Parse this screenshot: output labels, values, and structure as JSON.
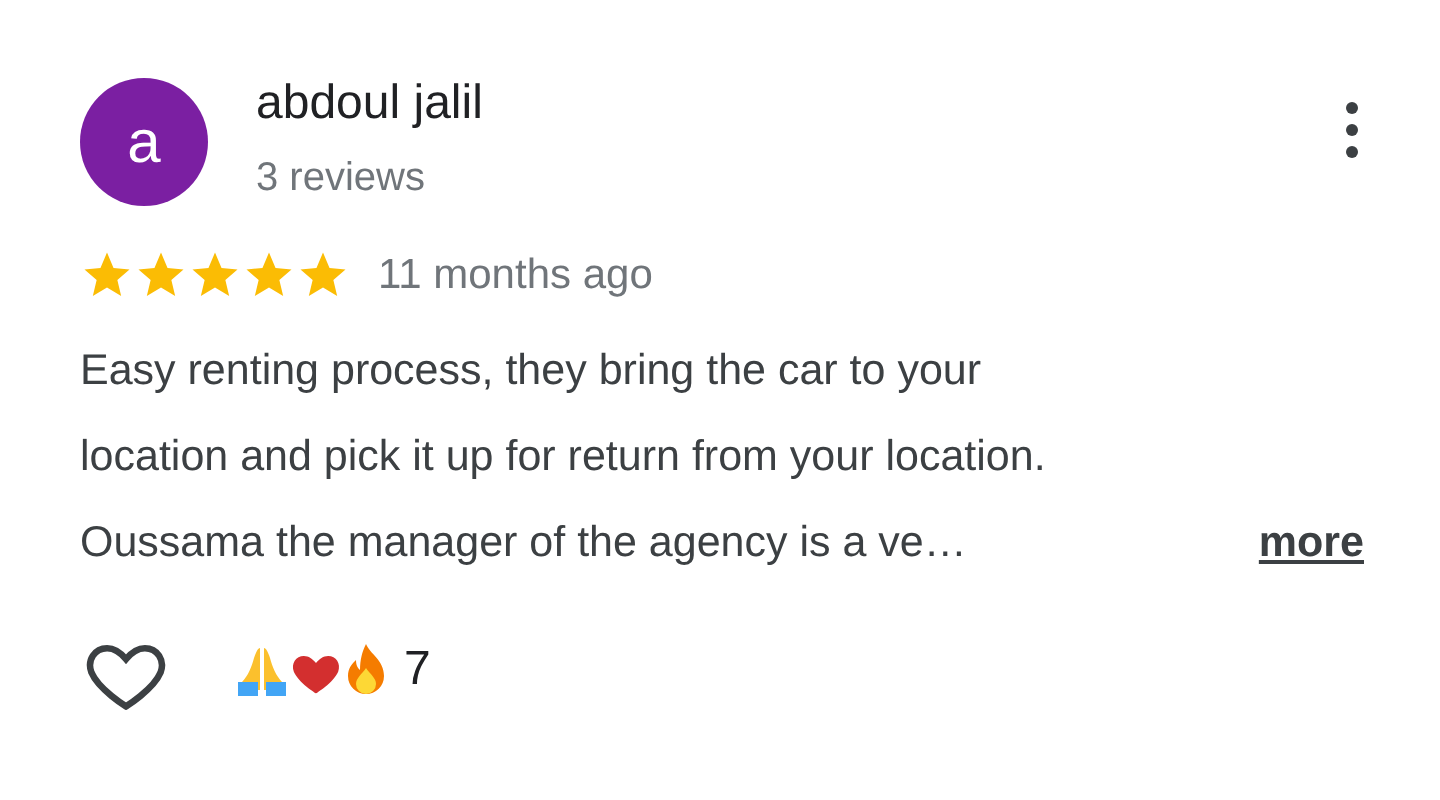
{
  "review": {
    "avatar_letter": "a",
    "author": "abdoul jalil",
    "reviews_count": "3 reviews",
    "stars": 5,
    "time": "11 months ago",
    "text_lines": [
      "Easy renting process, they bring the car to your",
      "location and pick it up for return from your location.",
      "Oussama the manager of the agency is a ve…"
    ],
    "more_link": "more",
    "liked": false,
    "reaction_count": "7"
  }
}
